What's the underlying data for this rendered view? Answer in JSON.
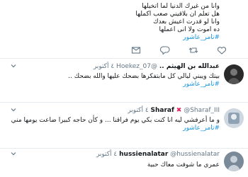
{
  "tweets": [
    {
      "lines": [
        "وانا من غيرك الدنيا لما اتخيلها",
        "هل تعلم ان بلاقيني صعب اكملها",
        "وانا لو قدرت اعيش بعدك",
        "ده اموت ولا انى اعملها"
      ],
      "hashtag": "#تامر_عاشور"
    },
    {
      "display_name": "عبدالله بن الهيثم ..",
      "handle": "@Hoekez_07",
      "date": "٤ أكتوبر",
      "lines": [
        "بيتك ويبني ليالي كل مابتفكرها بضحك عليها والله بضحك .."
      ],
      "hashtag": "#تامر_عاشور"
    },
    {
      "display_name": "Sharaf",
      "handle": "@Sharaf_III",
      "date": "٤ أكتوبر",
      "lines": [
        "و ما أعرفشي ليه انا كنت بكي يوم فراقنا ... و كأن حاجه كبيرا ضاعت يومها مني"
      ],
      "hashtag": "#تامر_عاشور"
    },
    {
      "display_name": "hussienalatar",
      "handle": "@hussienalatar",
      "date": "٤ أكتوبر",
      "lines": [
        "عمري ما شوفت معاك حبية"
      ]
    }
  ],
  "icons": {
    "reply": "reply-icon",
    "retweet": "retweet-icon",
    "like": "heart-icon",
    "dm": "direct-message-icon",
    "more": "chevron-down-icon",
    "red_x": "red-x-emoji"
  },
  "colors": {
    "hashtag": "#1b95e0",
    "muted": "#657786",
    "divider": "#e6ecf0",
    "red_x": "#e0245e"
  }
}
